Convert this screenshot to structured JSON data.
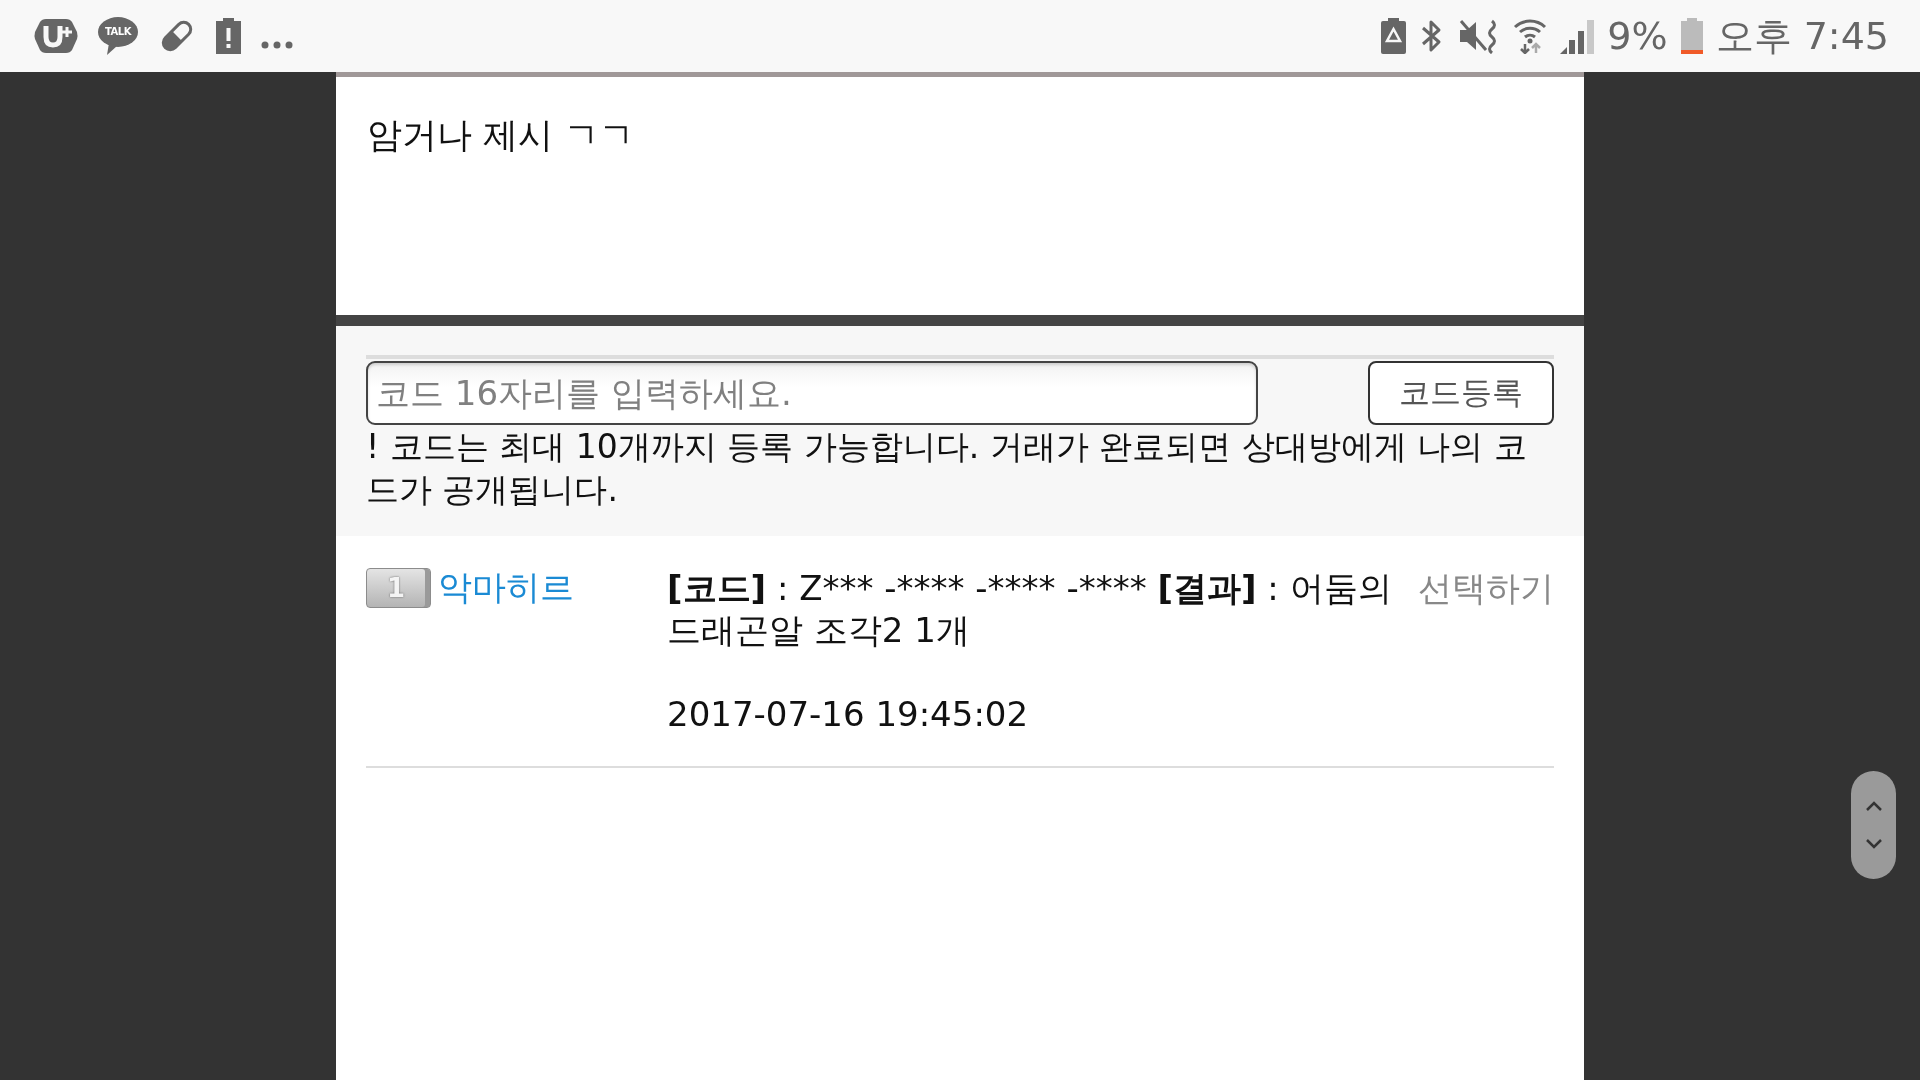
{
  "status_bar": {
    "chat_icon_label": "TALK",
    "battery_percent": "9%",
    "time": "오후 7:45"
  },
  "post": {
    "body": "암거나 제시 ㄱㄱ"
  },
  "code_form": {
    "input": {
      "placeholder": "코드 16자리를 입력하세요."
    },
    "submit_button": "코드등록",
    "notice": "! 코드는 최대 10개까지 등록 가능합니다. 거래가 완료되면 상대방에게 나의 코드가 공개됩니다."
  },
  "entries": [
    {
      "rank": "1",
      "user": "악마히르",
      "action": "선택하기",
      "detail": [
        {
          "text": "[코드]",
          "bold": true
        },
        {
          "text": " : Z*** -**** -**** -**** ",
          "bold": false
        },
        {
          "text": "[결과]",
          "bold": true
        },
        {
          "text": " : 어둠의 드래곤알 조각2 1개",
          "bold": false
        }
      ],
      "timestamp": "2017-07-16 19:45:02"
    }
  ]
}
